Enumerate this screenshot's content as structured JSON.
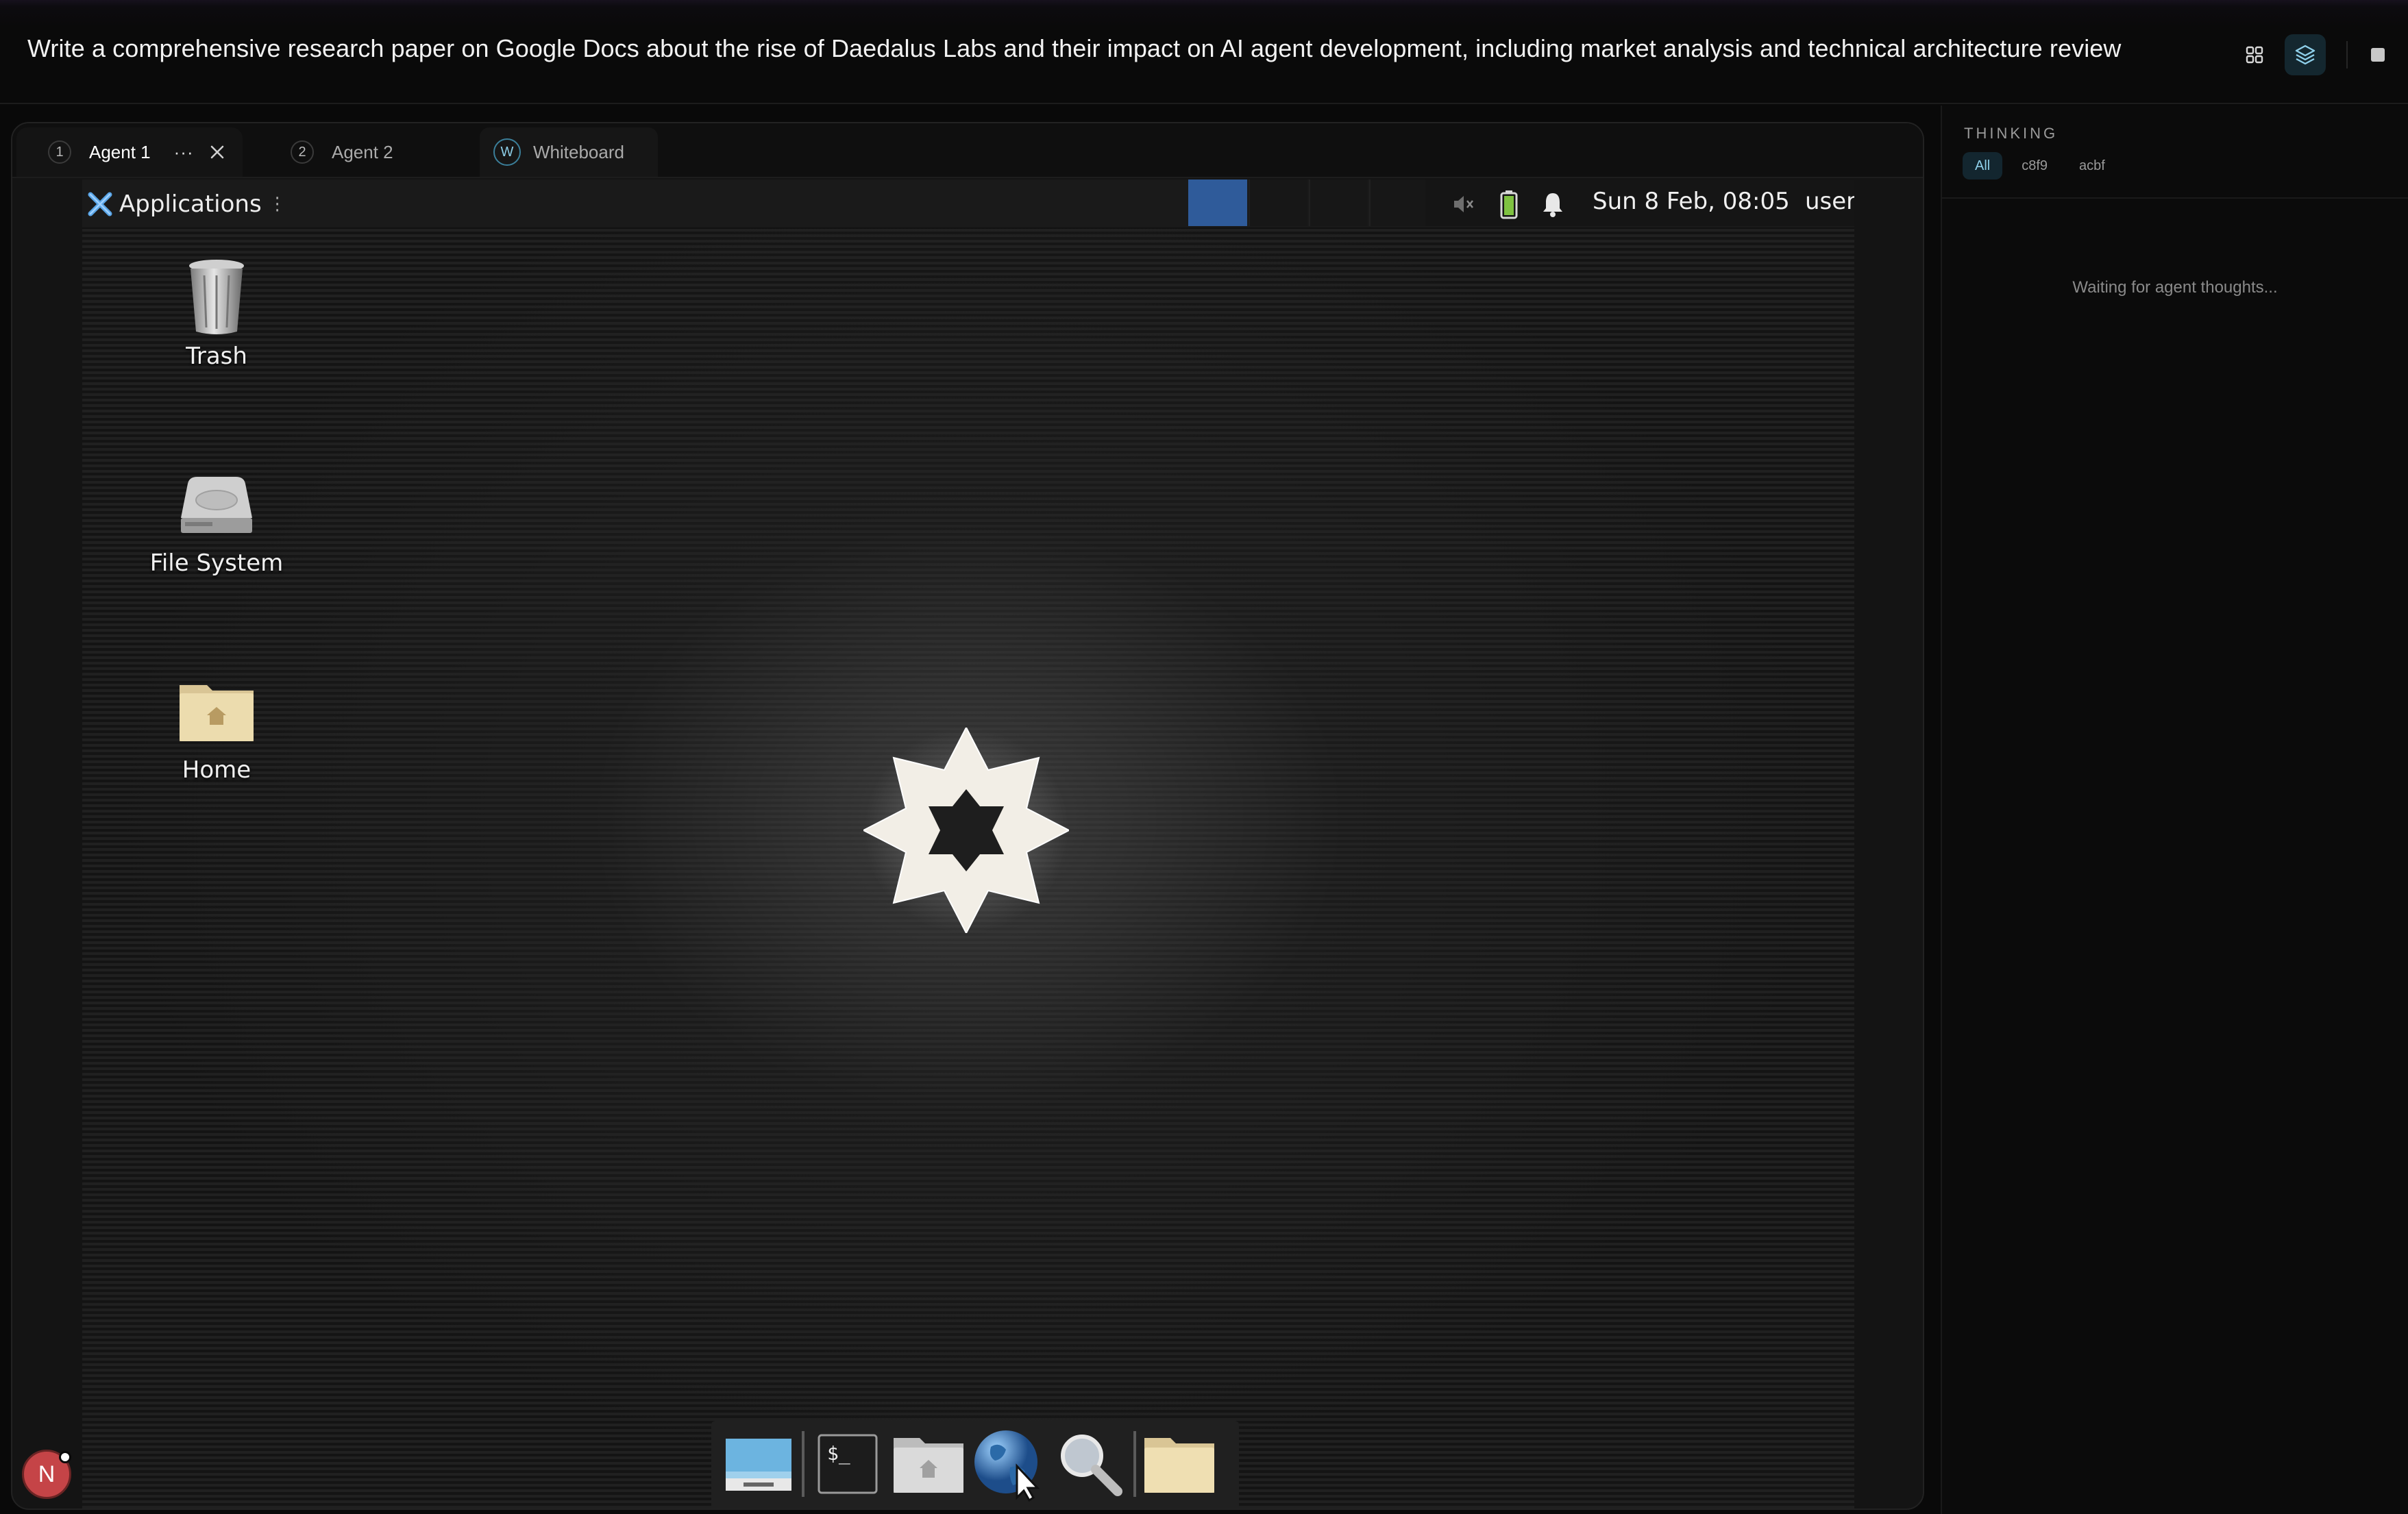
{
  "prompt": "Write a comprehensive research paper on Google Docs about the rise of Daedalus Labs and their impact on AI agent development, including market analysis and technical architecture review",
  "top_actions": {
    "grid_icon": "grid-icon",
    "layers_icon": "layers-icon",
    "stop_icon": "stop-icon"
  },
  "tabs": [
    {
      "num": "1",
      "label": "Agent 1",
      "menu": "···"
    },
    {
      "num": "2",
      "label": "Agent 2"
    },
    {
      "badge": "W",
      "label": "Whiteboard"
    }
  ],
  "desktop": {
    "panel": {
      "applications_label": "Applications",
      "clock": "Sun  8 Feb, 08:05",
      "user": "user"
    },
    "icons": [
      {
        "label": "Trash",
        "icon": "trash-icon"
      },
      {
        "label": "File System",
        "icon": "drive-icon"
      },
      {
        "label": "Home",
        "icon": "home-folder-icon"
      }
    ],
    "dock": [
      "show-desktop-icon",
      "terminal-icon",
      "file-manager-icon",
      "web-browser-icon",
      "search-icon",
      "folder-icon"
    ],
    "terminal_glyph": "$_"
  },
  "user_avatar": {
    "initial": "N"
  },
  "thinking": {
    "title": "THINKING",
    "filters": [
      "All",
      "c8f9",
      "acbf"
    ],
    "empty_text": "Waiting for agent thoughts..."
  },
  "colors": {
    "accent": "#8fd0ea",
    "workspace_active": "#2f5b9a",
    "avatar": "#c54447"
  }
}
